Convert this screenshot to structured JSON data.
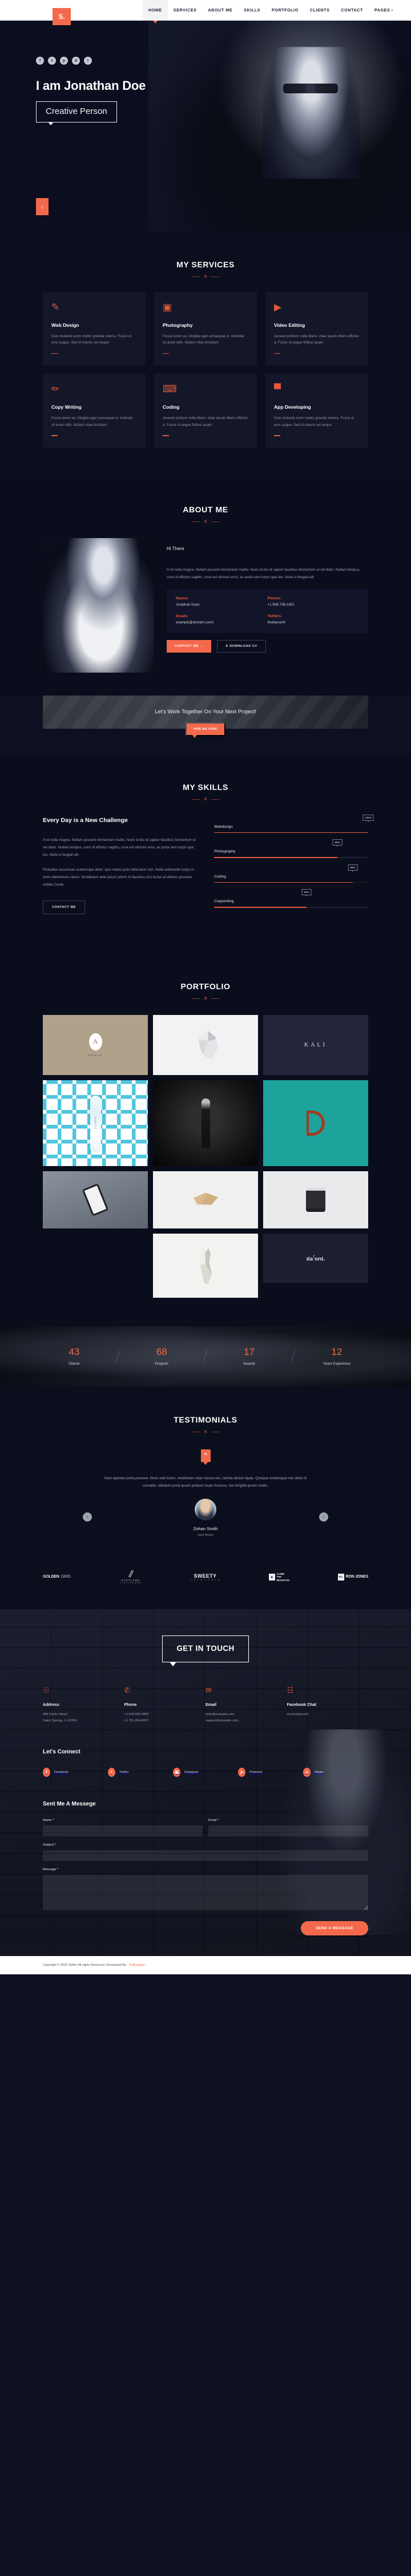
{
  "header": {
    "logo": "S.",
    "nav": [
      {
        "label": "HOME",
        "active": true
      },
      {
        "label": "SERVICES",
        "active": false
      },
      {
        "label": "ABOUT ME",
        "active": false
      },
      {
        "label": "SKILLS",
        "active": false
      },
      {
        "label": "PORTFOLIO",
        "active": false
      },
      {
        "label": "CLIENTS",
        "active": false
      },
      {
        "label": "CONTACT",
        "active": false
      },
      {
        "label": "PAGES",
        "active": false
      }
    ]
  },
  "hero": {
    "title": "I am Jonathan Doe",
    "typed": "Creative Person",
    "socials": [
      "f",
      "t",
      "p",
      "d",
      "i"
    ],
    "scroll_icon": "↓"
  },
  "services": {
    "title": "MY SERVICES",
    "items": [
      {
        "icon": "✎",
        "name": "Web Design",
        "text": "Duis molestie enim mattis gravida viverra. Fusce ut eros augue. Sed id mauris vel neque"
      },
      {
        "icon": "▣",
        "name": "Photography",
        "text": "Fusce lorem ex, fringilla eget consequat ut, molestie sit amet nibh. Nullam vitae tincidunt"
      },
      {
        "icon": "▶",
        "name": "Video Editing",
        "text": "Aenean pretium nulla libero, vitae iaculis libero efficitur a. Fusce ut augue finibus quam"
      },
      {
        "icon": "✏",
        "name": "Copy Writing",
        "text": "Fusce lorem ex, fringilla eget consequat ut, molestie sit amet nibh. Nullam vitae tincidunt"
      },
      {
        "icon": "⌨",
        "name": "Coding",
        "text": "Aenean pretium nulla libero, vitae iaculis libero efficitur a. Fusce ut augue finibus quam"
      },
      {
        "icon": "▀",
        "name": "App Developing",
        "text": "Duis molestie enim mattis gravida viverra. Fusce ut eros augue. Sed id mauris vel neque"
      }
    ]
  },
  "about": {
    "title": "ABOUT ME",
    "greeting": "Hi There",
    "text": "In id nulla magna. Nullam posuere fermentum mattis. Nunc id dui at sapien faucibus fermentum ut vel diam. Nullam tempus, nunc id efficitur sagittis, urna est ultricies eros, ac porta sem turpis quis leo. Nulla in feugiat elit.",
    "info": [
      {
        "key": "Names:",
        "value": "Jonathan Does"
      },
      {
        "key": "Phones:",
        "value": "+1 908-736-1801"
      },
      {
        "key": "Emails:",
        "value": "example@domain.coms"
      },
      {
        "key": "Twitters:",
        "value": "freelancer9"
      }
    ],
    "contact_btn": "CONTACT ME  →",
    "download_btn": "⬇  DOWNLOAD CV"
  },
  "cta": {
    "heading": "Let's Work Together On Your Next Project!",
    "button": "HIRE ME NOW!"
  },
  "skills": {
    "title": "MY SKILLS",
    "heading": "Every Day is a New Challenge",
    "paragraphs": [
      "In id nulla magna. Nullam posuere fermentum mattis. Nunc id dui at sapien faucibus fermentum ut vel diam. Nullam tempus, nunc id efficitur sagittis, urna est ultricies eros, ac porta sem turpis quis leo. Nulla in feugiat elit.",
      "Phasellus accumsan scelerisque dolor, quis mattis justo bibendum non. Nulla sollicitudin turpis in enim elementum varius. Vestibulum ante ipsum primis in faucibus orci luctus et ultrices posuere cubilia Curae"
    ],
    "button": "CONTACT ME",
    "bars": [
      {
        "label": "Webdesign",
        "value": 100,
        "text": "100%"
      },
      {
        "label": "Photography",
        "value": 80,
        "text": "80%"
      },
      {
        "label": "Coding",
        "value": 90,
        "text": "90%"
      },
      {
        "label": "Copywriting",
        "value": 60,
        "text": "60%"
      }
    ]
  },
  "portfolio": {
    "title": "PORTFOLIO",
    "items": [
      {
        "name": "pehaz-branding",
        "label": "PEHAZ",
        "mark": "A"
      },
      {
        "name": "polygon-horse",
        "label": ""
      },
      {
        "name": "kali-brand",
        "label": "KALI"
      },
      {
        "name": "purity-bottle",
        "label": "PURITY"
      },
      {
        "name": "moo-beer-bottle",
        "label": ""
      },
      {
        "name": "letter-d-poster",
        "label": "D"
      },
      {
        "name": "phone-mockup",
        "label": ""
      },
      {
        "name": "wooden-stool",
        "label": ""
      },
      {
        "name": "speaker-can",
        "label": ""
      },
      {
        "name": "origami-deer",
        "label": ""
      },
      {
        "name": "dafont-logo",
        "label": "da",
        "sup": "f",
        "tail": "ont."
      }
    ]
  },
  "counters": [
    {
      "number": "43",
      "label": "Clients"
    },
    {
      "number": "68",
      "label": "Projects"
    },
    {
      "number": "17",
      "label": "Awards"
    },
    {
      "number": "12",
      "label": "Years Experimce"
    }
  ],
  "testimonials": {
    "title": "TESTIMONIALS",
    "quote_glyph": "”",
    "text": "Nam egestas porta posuere. Nunc velit lorem, vestibulum vitae massa nec, lacinia dictum ligula. Quisque scelerisque nec dolor id convallis. stibulum porta ipsum pretium turpis rhoncus, non fringilla ipsum mattis.",
    "name": "Zohan Smith",
    "role": "John Brown",
    "prev": "‹",
    "next": "›"
  },
  "clients": [
    {
      "bold": "GOLDEN",
      "light": "GRID.",
      "type": "text"
    },
    {
      "bold": "FASTLANE",
      "sub": "VINOTHEQUE",
      "type": "leaf"
    },
    {
      "bold": "SWEETY",
      "sub": "C A F E T E R I A",
      "type": "center"
    },
    {
      "bold": "CLIMB\nTHE\nMOUNTAIN",
      "type": "stack",
      "sq": "⛰"
    },
    {
      "bold": "RON JONES",
      "type": "sq",
      "sq": "RJ"
    }
  ],
  "contact": {
    "title": "GET IN TOUCH",
    "info": [
      {
        "icon": "☉",
        "title": "Address",
        "lines": "999 Carter Street\nSailor Springs, IL 62434"
      },
      {
        "icon": "✆",
        "title": "Phone",
        "lines": "+1 618-689-9409\n+1 781-254-8437"
      },
      {
        "icon": "✉",
        "title": "Email",
        "lines": "hello@example.com\nsupport@example.com"
      },
      {
        "icon": "☷",
        "title": "Facebook Chat",
        "lines": "me.freelancer3"
      }
    ],
    "connect_title": "Let's Connect",
    "socials": [
      {
        "glyph": "f",
        "name": "Facebook"
      },
      {
        "glyph": "t",
        "name": "Twitter"
      },
      {
        "glyph": "▣",
        "name": "Instagram"
      },
      {
        "glyph": "p",
        "name": "Pinterest"
      },
      {
        "glyph": "s",
        "name": "Skype"
      }
    ],
    "form_title": "Sent Me A Messege",
    "fields": {
      "name_label": "Name *",
      "email_label": "Email *",
      "subject_label": "Subject *",
      "message_label": "Message *",
      "name_value": "",
      "email_value": "",
      "subject_value": "",
      "message_value": ""
    },
    "submit": "SEND A MESSAGE"
  },
  "footer": {
    "text": "Copyright © 2022 Selfer All rights Reserved. Developed By - ",
    "brand": "SoftHopper"
  },
  "colors": {
    "accent": "#f4694b",
    "accent_dark": "#e05a3c",
    "bg": "#0b0e1c",
    "card": "#14172a"
  }
}
